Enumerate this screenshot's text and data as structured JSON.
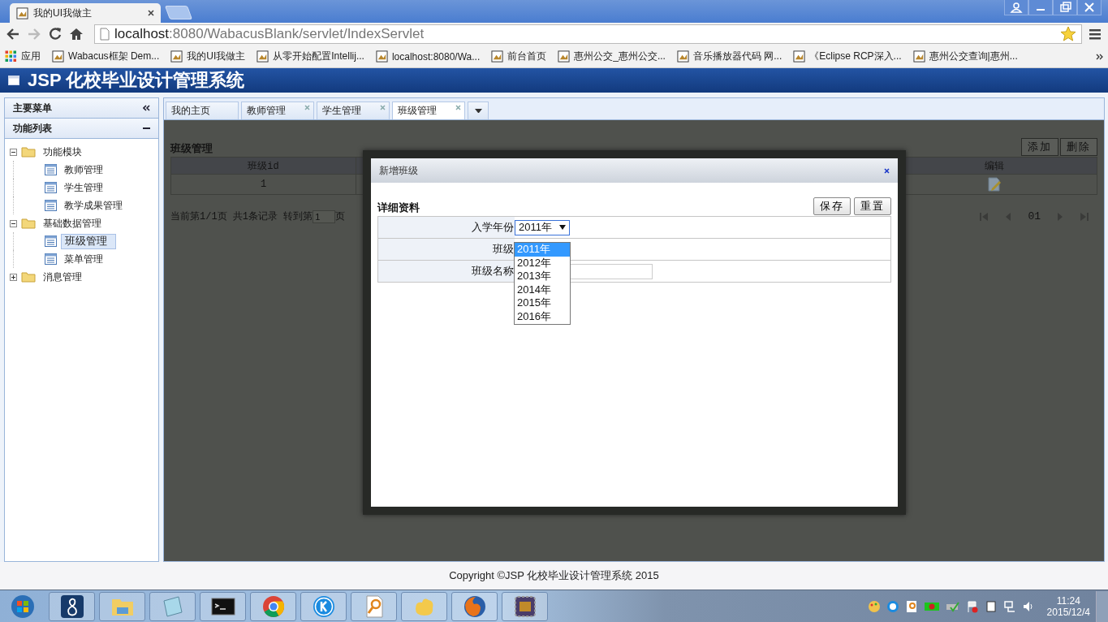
{
  "browser": {
    "tabs": [
      {
        "title": "我的UI我做主",
        "selected": true
      }
    ],
    "address": {
      "host": "localhost",
      "path": ":8080/WabacusBlank/servlet/IndexServlet"
    },
    "apps_label": "应用",
    "bookmarks": [
      {
        "label": "Wabacus框架 Dem..."
      },
      {
        "label": "我的UI我做主"
      },
      {
        "label": "从零开始配置Intellij..."
      },
      {
        "label": "localhost:8080/Wa..."
      },
      {
        "label": "前台首页"
      },
      {
        "label": "惠州公交_惠州公交..."
      },
      {
        "label": "音乐播放器代码 网..."
      },
      {
        "label": "《Eclipse RCP深入..."
      },
      {
        "label": "惠州公交查询|惠州..."
      }
    ]
  },
  "app": {
    "title": "JSP 化校毕业设计管理系统"
  },
  "sidebar": {
    "header": "主要菜单",
    "section": "功能列表",
    "tree": [
      {
        "label": "功能模块",
        "expanded": true,
        "children": [
          {
            "label": "教师管理",
            "selected": false
          },
          {
            "label": "学生管理",
            "selected": false
          },
          {
            "label": "教学成果管理",
            "selected": false
          }
        ]
      },
      {
        "label": "基础数据管理",
        "expanded": true,
        "children": [
          {
            "label": "班级管理",
            "selected": true
          },
          {
            "label": "菜单管理",
            "selected": false
          }
        ]
      },
      {
        "label": "消息管理",
        "expanded": false
      }
    ]
  },
  "tabs": [
    {
      "label": "我的主页",
      "closable": false,
      "selected": false
    },
    {
      "label": "教师管理",
      "closable": true,
      "selected": false
    },
    {
      "label": "学生管理",
      "closable": true,
      "selected": false
    },
    {
      "label": "班级管理",
      "closable": true,
      "selected": true
    }
  ],
  "page": {
    "title": "班级管理",
    "buttons": [
      "添加",
      "删除"
    ],
    "columns": [
      {
        "label": "班级id"
      },
      {
        "label": "编辑"
      }
    ],
    "rows": [
      {
        "id": "1"
      }
    ],
    "pager": {
      "text": "当前第1/1页 共1条记录 转到第",
      "input": "1",
      "suffix": "页",
      "page": "01"
    }
  },
  "dialog": {
    "title": "新增班级",
    "section": "详细资料",
    "buttons": [
      "保存",
      "重置"
    ],
    "fields": [
      {
        "label": "入学年份",
        "kind": "select",
        "value": "2011年"
      },
      {
        "label": "班级",
        "kind": "text"
      },
      {
        "label": "班级名称",
        "kind": "input"
      }
    ],
    "options": [
      {
        "label": "2011年",
        "selected": true
      },
      {
        "label": "2012年",
        "selected": false
      },
      {
        "label": "2013年",
        "selected": false
      },
      {
        "label": "2014年",
        "selected": false
      },
      {
        "label": "2015年",
        "selected": false
      },
      {
        "label": "2016年",
        "selected": false
      }
    ]
  },
  "footer": "Copyright ©JSP 化校毕业设计管理系统 2015",
  "clock": {
    "time": "11:24",
    "date": "2015/12/4"
  }
}
